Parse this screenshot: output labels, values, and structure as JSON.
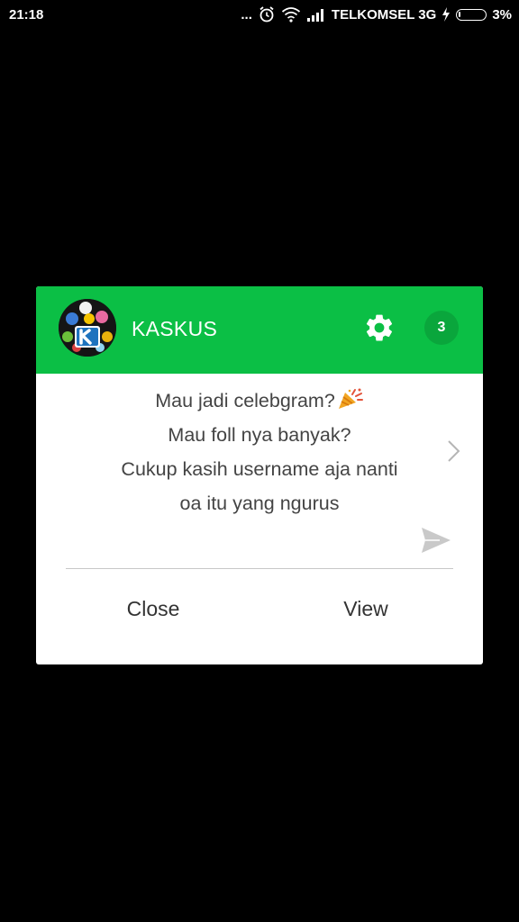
{
  "status_bar": {
    "time": "21:18",
    "dots": "...",
    "carrier": "TELKOMSEL 3G",
    "battery": "3%",
    "icons": [
      "alarm-icon",
      "wifi-icon",
      "signal-icon",
      "charging-icon",
      "battery-icon"
    ]
  },
  "notification": {
    "app_name": "KASKUS",
    "count": "3",
    "message_lines": [
      "Mau jadi celebgram?",
      "Mau foll nya banyak?",
      "Cukup kasih username aja nanti",
      "oa itu yang ngurus"
    ],
    "message_icon": "party-popper-icon",
    "header_color": "#0bbf45",
    "actions": {
      "close": "Close",
      "view": "View"
    }
  }
}
